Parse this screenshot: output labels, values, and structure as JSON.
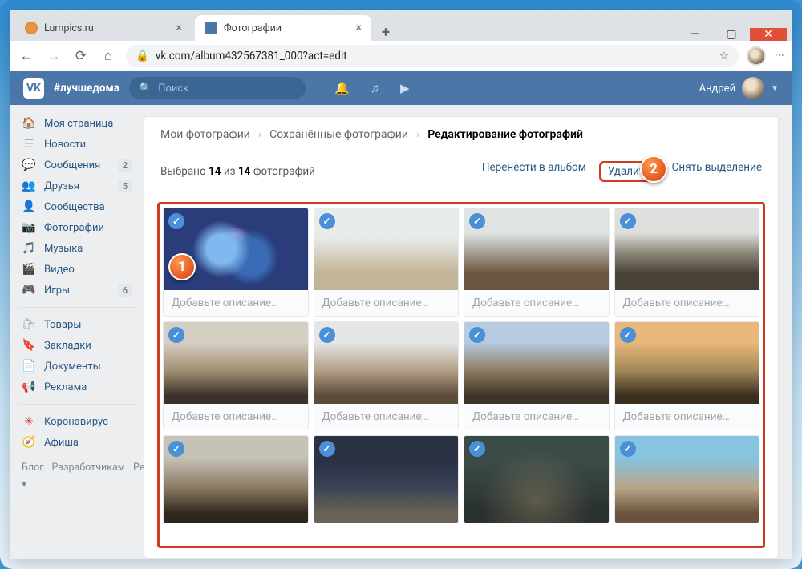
{
  "window": {
    "min": "—",
    "max": "▢",
    "close": "✕"
  },
  "tabs": [
    {
      "title": "Lumpics.ru",
      "active": false
    },
    {
      "title": "Фотографии",
      "active": true
    }
  ],
  "url": "vk.com/album432567381_000?act=edit",
  "vk": {
    "logo": "VK",
    "hashtag": "#лучшедома",
    "search_ph": "Поиск",
    "user": "Андрей"
  },
  "sidebar": {
    "items": [
      {
        "ico": "🏠",
        "label": "Моя страница"
      },
      {
        "ico": "☰",
        "label": "Новости"
      },
      {
        "ico": "💬",
        "label": "Сообщения",
        "badge": "2"
      },
      {
        "ico": "👥",
        "label": "Друзья",
        "badge": "5"
      },
      {
        "ico": "👤",
        "label": "Сообщества"
      },
      {
        "ico": "📷",
        "label": "Фотографии"
      },
      {
        "ico": "🎵",
        "label": "Музыка"
      },
      {
        "ico": "🎬",
        "label": "Видео"
      },
      {
        "ico": "🎮",
        "label": "Игры",
        "badge": "6"
      }
    ],
    "items2": [
      {
        "ico": "🛍",
        "label": "Товары"
      },
      {
        "ico": "🔖",
        "label": "Закладки"
      },
      {
        "ico": "📄",
        "label": "Документы"
      },
      {
        "ico": "📢",
        "label": "Реклама"
      }
    ],
    "items3": [
      {
        "ico": "✳",
        "label": "Коронавирус",
        "color": "#d24848"
      },
      {
        "ico": "🧭",
        "label": "Афиша"
      }
    ],
    "foot": [
      "Блог",
      "Разработчикам",
      "Реклама",
      "Ещё ▾"
    ]
  },
  "breadcrumbs": [
    "Мои фотографии",
    "Сохранённые фотографии",
    "Редактирование фотографий"
  ],
  "selection": {
    "prefix": "Выбрано ",
    "n": "14",
    "mid": " из ",
    "total": "14",
    "suffix": " фотографий"
  },
  "actions": {
    "move": "Перенести в альбом",
    "delete": "Удалить",
    "deselect": "Снять выделение"
  },
  "caption_ph": "Добавьте описание…",
  "markers": {
    "m1": "1",
    "m2": "2"
  }
}
